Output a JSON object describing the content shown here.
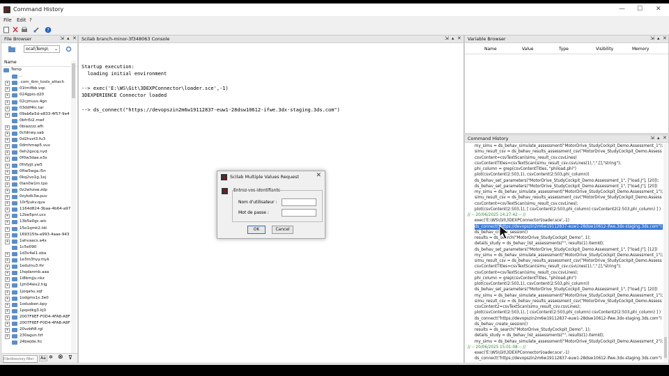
{
  "window": {
    "title": "Command History",
    "minimize": "—",
    "maximize": "☐",
    "close": "✕"
  },
  "menu": [
    "File",
    "Edit",
    "?"
  ],
  "file_browser": {
    "title": "File Browser",
    "path": "ocal\\Temp\\",
    "column": "Name",
    "root": "Temp",
    "items": [
      "..",
      ".com_ibm_tools_attach",
      "01tmlfbb.vqc",
      "024gpio.d20",
      "02cjmuvs.4gn",
      "03ddf4tc.tar",
      "09ab6e5d-e833-4f57-9e4",
      "0bfri5i2.mwf",
      "0biazzzz.efh",
      "0cfdnwy.uab",
      "0d2hvzt3.fu3",
      "0dmhmap5.vuv",
      "0eh2gxcq.nyd",
      "0f0w3dae.e3x",
      "0fnfyjjt.yw5",
      "0ftw5wga.l5n",
      "0kq2vo1g.1ej",
      "0lan0w1m.tpo",
      "0z2whzsw.zdp",
      "0zykdk3w.puv",
      "10r5jukv.qya",
      "1164d824-3baa-4b64-a97",
      "12be5pnl.ucs",
      "13b5e0gc.wlc",
      "15o1qmk2.tdi",
      "169315fa-a993-4aae-943",
      "1ahvaacs.a4x",
      "1c5e090",
      "1d3v4al1.oba",
      "1e3m3hyy.myk",
      "1edulnu3.lhr",
      "1hqdanmb.aaa",
      "1i8bmjju.nkz",
      "1jm04wx2.hig",
      "1joqahu.sqf",
      "1odgms1x.3e0",
      "1odusben.bpy",
      "1pqxdkg3.kj0",
      "2007F6EF-F0D4-4FA8-A8F",
      "2007F6EF-F0D4-4FA8-A8F",
      "20vzbft8.rgl",
      "230agun.fzf",
      "24bwjde.ltc"
    ],
    "filter_placeholder": "File/directory filter",
    "filter_aa": "Aa"
  },
  "console": {
    "title": "Scilab branch-minor-3f348063 Console",
    "lines": [
      "Startup execution:",
      "  loading initial environment",
      "",
      "--> exec('E:\\WS\\Git\\3DEXPConnector\\loader.sce',-1)",
      "3DEXPERIENCE Connector loaded",
      "",
      "--> ds_connect(\"https://devopszin2m6w19112837-euw1-28dsw10612-ifwe.3dx-staging.3ds.com\")"
    ]
  },
  "variable_browser": {
    "title": "Variable Browser",
    "columns": [
      "Name",
      "Value",
      "Type",
      "Visibility",
      "Memory"
    ]
  },
  "command_history": {
    "title": "Command History",
    "lines": [
      "my_simu = ds_behav_simulate_assessment(\"MotorDrive_StudyCockpit_Demo.Assessment_1\");",
      "simu_result_csv = ds_behav_results_assessment_csv(\"MotorDrive_StudyCockpit_Demo.Assess",
      "csvContent=csvTextScan(simu_result_csv.csvLines)",
      "csvContentTitles=csvTextScan(simu_result_csv.csvLines(1),\",\",[],\"string\");",
      "phi_column = grep(csvContentTitles, \"phiload.phi\")",
      "plot(csvContent(2:503,1), csvContent(2:503,phi_column))",
      "ds_behav_set_parameters(\"MotorDrive_StudyCockpit_Demo.Assessment_1\", [\"load.J\"], [20]);",
      "ds_behav_set_parameters(\"MotorDrive_StudyCockpit_Demo.Assessment_1\", [\"load.J\"], [20])",
      "my_simu = ds_behav_simulate_assessment(\"MotorDrive_StudyCockpit_Demo.Assessment_1\");",
      "simu_result_csv = ds_behav_results_assessment_csv(\"MotorDrive_StudyCockpit_Demo.Assess",
      "csvContent=csvTextScan(simu_result_csv.csvLines);",
      "plot(csvContent(2:503,1), [ csvContent(2:503,phi_column) csvContent2(2:503,phi_column) ] )",
      "// -- 20/06/2025 14:27:42 -- //",
      "exec('E:\\WS\\Git\\3DEXPConnector\\loader.sce',-1)",
      "ds_connect(\"https://devopszin2m6w19112837-euw1-28dsw10612-ifwe.3dx-staging.3ds.com\")",
      "ds_behav_create_session()",
      "results = ds_search(\"MotorDrive_StudyCockpit_Demo\", 1);",
      "details_study = ds_behav_list_assessments(\"\", results(1).itemId);",
      "ds_behav_set_parameters(\"MotorDrive_StudyCockpit_Demo.Assessment_1\", [\"load.J\"], [12])",
      "my_simu = ds_behav_simulate_assessment(\"MotorDrive_StudyCockpit_Demo.Assessment_1\");",
      "simu_result_csv = ds_behav_results_assessment_csv(\"MotorDrive_StudyCockpit_Demo.Assess",
      "csvContentTitles=csvTextScan(simu_result_csv.csvLines(1),\",\",[],\"string\");",
      "csvContent=csvTextScan(simu_result_csv.csvLines);",
      "phi_column = grep(csvContentTitles, \"phiload.phi\")",
      "plot(csvContent(2:503,1), csvContent(2:503,phi_column))",
      "ds_behav_set_parameters(\"MotorDrive_StudyCockpit_Demo.Assessment_1\", [\"load.J\"], [20])",
      "my_simu = ds_behav_simulate_assessment(\"MotorDrive_StudyCockpit_Demo.Assessment_1\");",
      "simu_result_csv = ds_behav_results_assessment_csv(\"MotorDrive_StudyCockpit_Demo.Assess",
      "csvContent2=csvTextScan(simu_result_csv.csvLines);",
      "plot(csvContent(2:503,1), [ csvContent(2:503,phi_column) csvContent2(2:503,phi_column) ] )",
      "ds_connect(\"https://devopszin2m6w19112837-euw1-28dsw10612-ifwe.3dx-staging.3ds.com\")",
      "ds_behav_create_session()",
      "results = ds_search(\"MotorDrive_StudyCockpit_Demo\", 1);",
      "details_study = ds_behav_list_assessments(\"\", results(1).itemId);",
      "my_simu = ds_behav_simulate_assessment(\"MotorDrive_StudyCockpit_Demo.Assessment_2\");",
      "// -- 20/06/2025 15:01:08 -- //",
      "exec('E:\\WS\\Git\\3DEXPConnector\\loader.sce',-1)",
      "ds_connect(\"https://devopszin2m6w19112837-euw1-28dsw10612-ifwe.3dx-staging.3ds.com\")"
    ]
  },
  "dialog": {
    "title": "Scilab Multiple Values Request",
    "prompt": "Entrez vos identifiants",
    "user_label": "Nom d'utilisateur :",
    "pass_label": "Mot de passe :",
    "user_value": "",
    "pass_value": "",
    "ok": "OK",
    "cancel": "Cancel"
  },
  "colors": {
    "selection": "#3a78d6",
    "date_green": "#2e8b2e",
    "accent": "#1d5fbf"
  }
}
